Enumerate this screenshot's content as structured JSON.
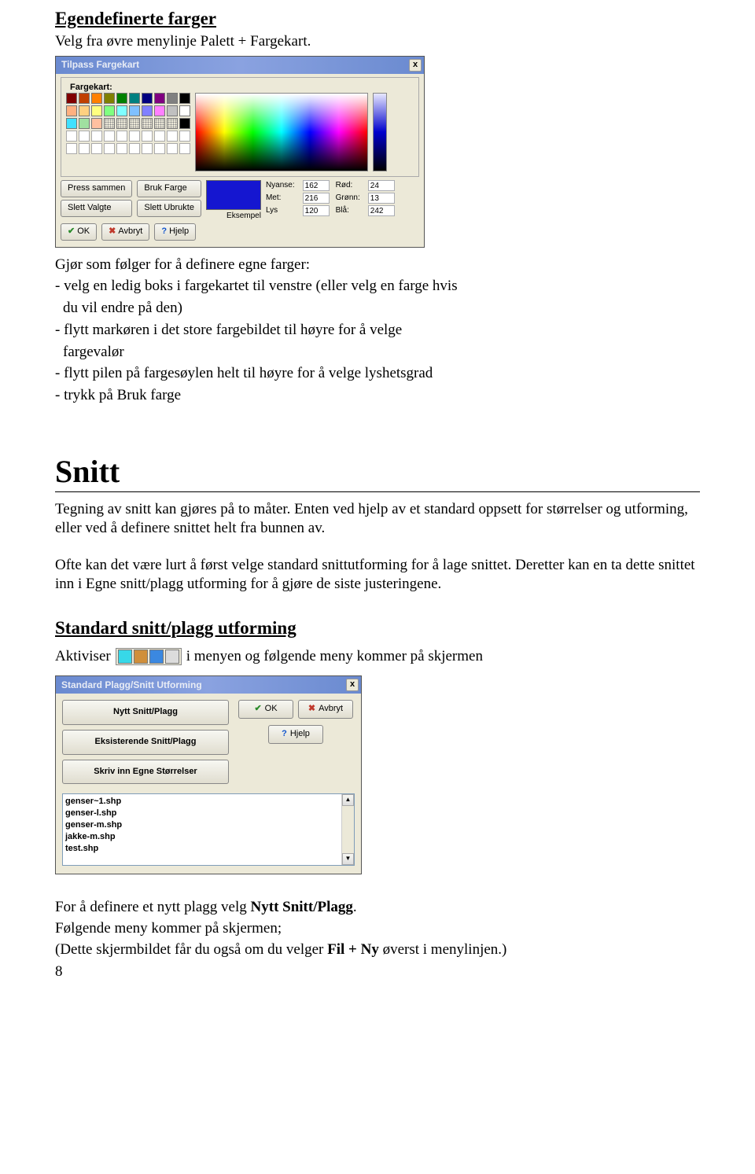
{
  "heading1": "Egendefinerte farger",
  "heading1_sub": "Velg fra øvre menylinje Palett + Fargekart.",
  "color_dialog": {
    "title": "Tilpass Fargekart",
    "close": "x",
    "fieldset_label": "Fargekart:",
    "btn_press": "Press sammen",
    "btn_use": "Bruk Farge",
    "btn_del_sel": "Slett Valgte",
    "btn_del_unused": "Slett Ubrukte",
    "btn_ok": "OK",
    "btn_cancel": "Avbryt",
    "btn_help": "Hjelp",
    "sample_label": "Eksempel",
    "labels": {
      "nyanse": "Nyanse:",
      "met": "Met:",
      "lys": "Lys",
      "rod": "Rød:",
      "gronn": "Grønn:",
      "bla": "Blå:"
    },
    "values": {
      "nyanse": "162",
      "met": "216",
      "lys": "120",
      "rod": "24",
      "gronn": "13",
      "bla": "242"
    }
  },
  "instructions_intro": "Gjør som følger for å definere egne farger:",
  "instructions": {
    "l1": "- velg en ledig boks i fargekartet til venstre (eller velg en farge hvis",
    "l1b": "du vil endre på den)",
    "l2": "- flytt markøren i det store fargebildet til høyre for å velge",
    "l2b": "fargevalør",
    "l3": "- flytt pilen på fargesøylen helt til høyre for å velge lyshetsgrad",
    "l4": "- trykk på Bruk farge"
  },
  "snitt_heading": "Snitt",
  "snitt_p1": "Tegning av snitt kan gjøres på to måter. Enten ved hjelp av et standard oppsett for størrelser og utforming, eller ved å definere snittet helt fra bunnen av.",
  "snitt_p2": "Ofte kan det være lurt å først velge standard snittutforming for å lage snittet. Deretter kan en ta dette snittet inn i Egne snitt/plagg utforming for å gjøre de siste justeringene.",
  "standard_heading": "Standard snitt/plagg utforming",
  "aktiviser_pre": "Aktiviser",
  "aktiviser_post": "i menyen og følgende meny kommer på skjermen",
  "snitt_dialog": {
    "title": "Standard Plagg/Snitt Utforming",
    "close": "x",
    "btn_new": "Nytt Snitt/Plagg",
    "btn_existing": "Eksisterende Snitt/Plagg",
    "btn_sizes": "Skriv inn Egne Størrelser",
    "btn_ok": "OK",
    "btn_cancel": "Avbryt",
    "btn_help": "Hjelp",
    "list": {
      "i0": "genser~1.shp",
      "i1": "genser-l.shp",
      "i2": "genser-m.shp",
      "i3": "jakke-m.shp",
      "i4": "test.shp"
    }
  },
  "trailing": {
    "p1a": "For å definere et nytt plagg velg ",
    "p1b": "Nytt Snitt/Plagg",
    "p1c": ".",
    "p2": "Følgende meny kommer på skjermen;",
    "p3a": " (Dette skjermbildet får du også om du velger ",
    "p3b": "Fil + Ny",
    "p3c": " øverst i menylinjen.)"
  },
  "page_number": "8"
}
